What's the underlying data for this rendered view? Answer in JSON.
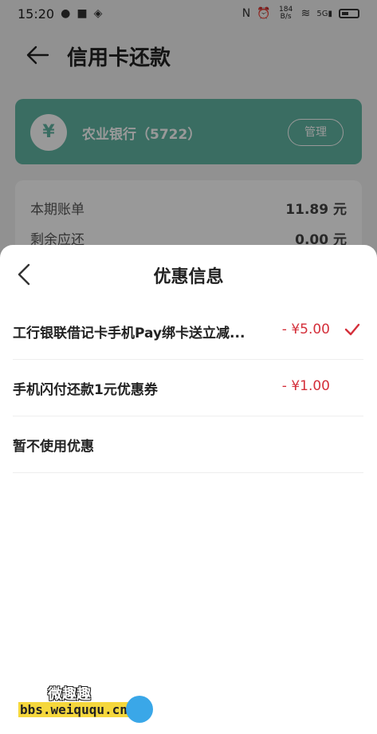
{
  "status_bar": {
    "time": "15:20",
    "net_speed_value": "184",
    "net_speed_unit": "B/s",
    "signal": "5G"
  },
  "header": {
    "title": "信用卡还款"
  },
  "card": {
    "bank_name": "农业银行（5722）",
    "manage_label": "管理",
    "logo_glyph": "¥"
  },
  "bill": {
    "rows": [
      {
        "label": "本期账单",
        "value": "11.89 元"
      },
      {
        "label": "剩余应还",
        "value": "0.00 元"
      }
    ]
  },
  "sheet": {
    "title": "优惠信息",
    "options": [
      {
        "label": "工行银联借记卡手机Pay绑卡送立减...",
        "amount": "- ¥5.00",
        "selected": true
      },
      {
        "label": "手机闪付还款1元优惠券",
        "amount": "- ¥1.00",
        "selected": false
      },
      {
        "label": "暂不使用优惠",
        "amount": "",
        "selected": false
      }
    ]
  },
  "watermark": {
    "text": "微趣趣",
    "url": "bbs.weiququ.cn"
  },
  "colors": {
    "accent_red": "#d42f3a",
    "card_green": "#62b6a3"
  }
}
